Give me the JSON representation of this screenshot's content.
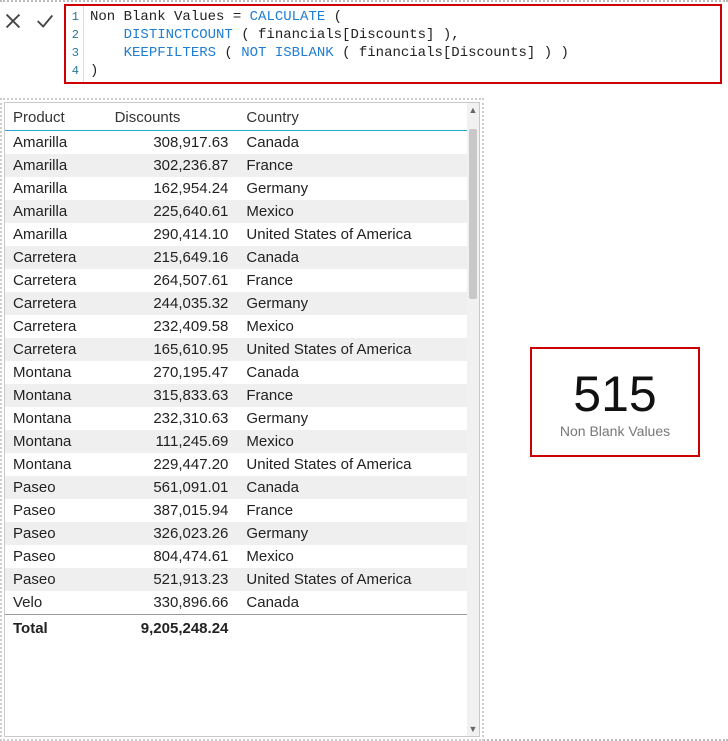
{
  "formula": {
    "gutter": [
      "1",
      "2",
      "3",
      "4"
    ],
    "line1_a": "Non Blank Values = ",
    "line1_b": "CALCULATE",
    "line1_c": " (",
    "line2_a": "    ",
    "line2_b": "DISTINCTCOUNT",
    "line2_c": " ( financials[Discounts] ),",
    "line3_a": "    ",
    "line3_b": "KEEPFILTERS",
    "line3_c": " ( ",
    "line3_d": "NOT ISBLANK",
    "line3_e": " ( financials[Discounts] ) )",
    "line4": ")"
  },
  "table": {
    "headers": {
      "c1": "Product",
      "c2": "Discounts",
      "c3": "Country"
    },
    "rows": [
      {
        "product": "Amarilla",
        "discounts": "308,917.63",
        "country": "Canada"
      },
      {
        "product": "Amarilla",
        "discounts": "302,236.87",
        "country": "France"
      },
      {
        "product": "Amarilla",
        "discounts": "162,954.24",
        "country": "Germany"
      },
      {
        "product": "Amarilla",
        "discounts": "225,640.61",
        "country": "Mexico"
      },
      {
        "product": "Amarilla",
        "discounts": "290,414.10",
        "country": "United States of America"
      },
      {
        "product": "Carretera",
        "discounts": "215,649.16",
        "country": "Canada"
      },
      {
        "product": "Carretera",
        "discounts": "264,507.61",
        "country": "France"
      },
      {
        "product": "Carretera",
        "discounts": "244,035.32",
        "country": "Germany"
      },
      {
        "product": "Carretera",
        "discounts": "232,409.58",
        "country": "Mexico"
      },
      {
        "product": "Carretera",
        "discounts": "165,610.95",
        "country": "United States of America"
      },
      {
        "product": "Montana",
        "discounts": "270,195.47",
        "country": "Canada"
      },
      {
        "product": "Montana",
        "discounts": "315,833.63",
        "country": "France"
      },
      {
        "product": "Montana",
        "discounts": "232,310.63",
        "country": "Germany"
      },
      {
        "product": "Montana",
        "discounts": "111,245.69",
        "country": "Mexico"
      },
      {
        "product": "Montana",
        "discounts": "229,447.20",
        "country": "United States of America"
      },
      {
        "product": "Paseo",
        "discounts": "561,091.01",
        "country": "Canada"
      },
      {
        "product": "Paseo",
        "discounts": "387,015.94",
        "country": "France"
      },
      {
        "product": "Paseo",
        "discounts": "326,023.26",
        "country": "Germany"
      },
      {
        "product": "Paseo",
        "discounts": "804,474.61",
        "country": "Mexico"
      },
      {
        "product": "Paseo",
        "discounts": "521,913.23",
        "country": "United States of America"
      },
      {
        "product": "Velo",
        "discounts": "330,896.66",
        "country": "Canada"
      }
    ],
    "total": {
      "label": "Total",
      "value": "9,205,248.24"
    }
  },
  "card": {
    "value": "515",
    "label": "Non Blank Values"
  }
}
